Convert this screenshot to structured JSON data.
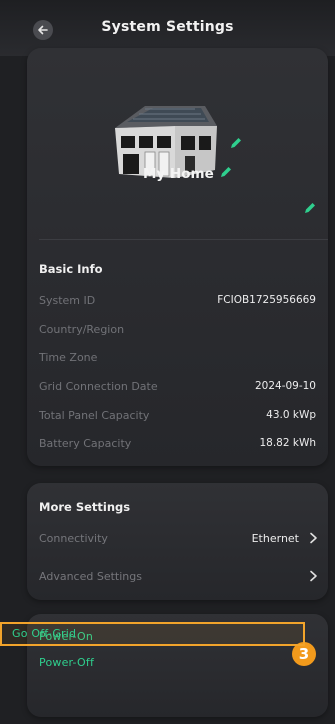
{
  "header": {
    "title": "System Settings"
  },
  "system": {
    "home_name": "My Home",
    "basic_info": {
      "title": "Basic Info",
      "rows": [
        {
          "label": "System ID",
          "value": "FCIOB1725956669"
        },
        {
          "label": "Country/Region",
          "value": ""
        },
        {
          "label": "Time Zone",
          "value": ""
        },
        {
          "label": "Grid Connection Date",
          "value": "2024-09-10"
        },
        {
          "label": "Total Panel Capacity",
          "value": "43.0 kWp"
        },
        {
          "label": "Battery Capacity",
          "value": "18.82 kWh"
        }
      ]
    }
  },
  "more_settings": {
    "title": "More Settings",
    "connectivity": {
      "label": "Connectivity",
      "value": "Ethernet"
    },
    "advanced": {
      "label": "Advanced Settings"
    }
  },
  "power": {
    "items": [
      "Power-On",
      "Power-Off",
      "Go Off-Grid"
    ],
    "step_badge": "3"
  },
  "colors": {
    "background": "#1f2023",
    "card": "#2c2d31",
    "accent_green": "#2fcf8e",
    "highlight_orange": "#f2a42b"
  },
  "icons": [
    "back-arrow-icon",
    "house-icon",
    "pencil-icon",
    "chevron-right-icon"
  ]
}
